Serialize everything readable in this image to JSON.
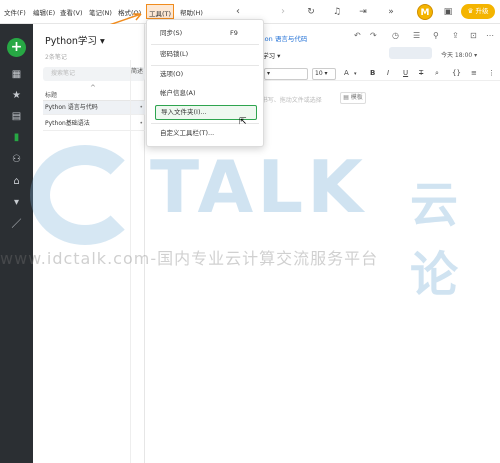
{
  "menubar": {
    "items": [
      "文件(F)",
      "编辑(E)",
      "查看(V)",
      "笔记(N)",
      "格式(O)",
      "工具(T)",
      "帮助(H)"
    ],
    "upgrade_label": "升级",
    "avatar_letter": "M"
  },
  "sidebar": {
    "icons": [
      "grid-icon",
      "star-icon",
      "note-icon",
      "notebook-icon",
      "people-icon",
      "tag-icon",
      "trash-icon",
      "pen-icon"
    ]
  },
  "list": {
    "notebook_title": "Python学习 ▾",
    "note_count": "2条笔记",
    "search_placeholder": "搜索笔记",
    "col_title": "标题",
    "col_other": "简述",
    "notes": [
      {
        "title": "Python 语言与代码"
      },
      {
        "title": "Python基础语法"
      }
    ]
  },
  "editor": {
    "title": "thon 语言与代码",
    "notebook": "n学习 ▾",
    "time": "今天 18:00 ▾",
    "font_size": "10",
    "placeholder": "n书写、拖动文件或选择",
    "template_label": "模板"
  },
  "dropdown": {
    "items": [
      {
        "label": "同步(S)",
        "shortcut": "F9"
      },
      {
        "label": "密码锁(L)",
        "shortcut": ""
      },
      {
        "label": "选项(O)",
        "shortcut": ""
      },
      {
        "label": "帐户信息(A)",
        "shortcut": ""
      },
      {
        "label": "导入文件夹(I)...",
        "shortcut": ""
      },
      {
        "label": "自定义工具栏(T)...",
        "shortcut": ""
      }
    ]
  },
  "watermark": {
    "brand": "TALK",
    "brand_cn": "云论",
    "url": "www.idctalk.com-国内专业云计算交流服务平台"
  },
  "colors": {
    "accent_orange": "#f08c1e",
    "accent_green": "#27a844",
    "link_blue": "#1f6fd6",
    "sidebar_bg": "#2b2f33",
    "upgrade_gold": "#f4b400"
  }
}
